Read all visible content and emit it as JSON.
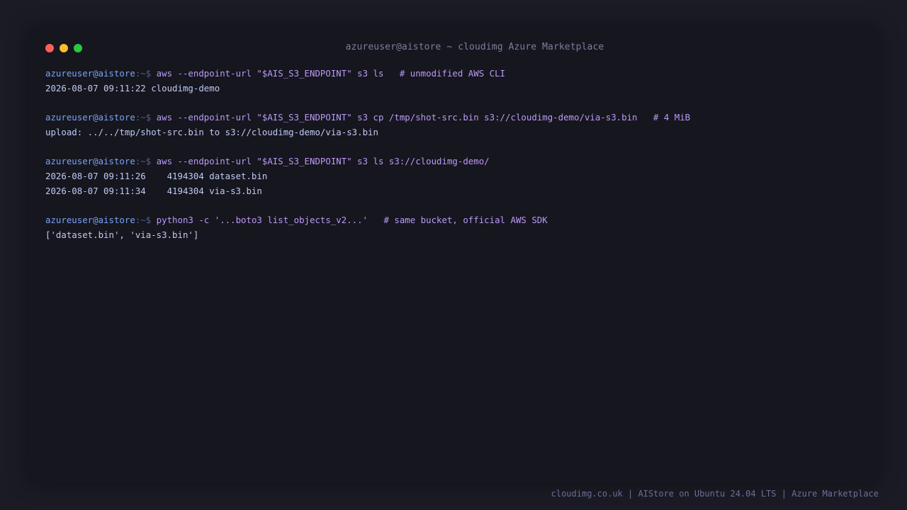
{
  "window": {
    "title": "azureuser@aistore ~ cloudimg Azure Marketplace",
    "buttons": [
      "close",
      "minimize",
      "maximize"
    ]
  },
  "prompt": {
    "user": "azureuser@aistore",
    "sep": ":~$ "
  },
  "blocks": [
    {
      "command": "aws --endpoint-url \"$AIS_S3_ENDPOINT\" s3 ls   # unmodified AWS CLI",
      "output": [
        "2026-08-07 09:11:22 cloudimg-demo"
      ]
    },
    {
      "command": "aws --endpoint-url \"$AIS_S3_ENDPOINT\" s3 cp /tmp/shot-src.bin s3://cloudimg-demo/via-s3.bin   # 4 MiB",
      "output": [
        "upload: ../../tmp/shot-src.bin to s3://cloudimg-demo/via-s3.bin"
      ]
    },
    {
      "command": "aws --endpoint-url \"$AIS_S3_ENDPOINT\" s3 ls s3://cloudimg-demo/",
      "output": [
        "2026-08-07 09:11:26    4194304 dataset.bin",
        "2026-08-07 09:11:34    4194304 via-s3.bin"
      ]
    },
    {
      "command": "python3 -c '...boto3 list_objects_v2...'   # same bucket, official AWS SDK",
      "output": [
        "['dataset.bin', 'via-s3.bin']"
      ]
    }
  ],
  "footer": "cloudimg.co.uk | AIStore on Ubuntu 24.04 LTS | Azure Marketplace",
  "colors": {
    "background": "#1b1b25",
    "window": "#16161e",
    "prompt_user": "#7aa2f7",
    "command": "#bb9af7",
    "output": "#c0caf5",
    "close": "#ff5f57",
    "minimize": "#febc2e",
    "maximize": "#28c840"
  }
}
